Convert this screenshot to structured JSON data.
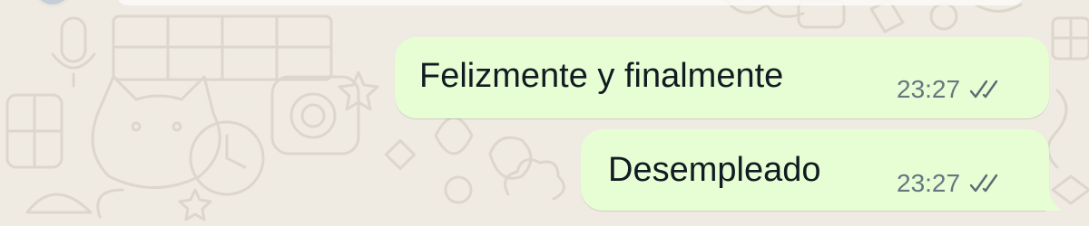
{
  "chat": {
    "background_color": "#efeae2",
    "outgoing_bubble_color": "#e7fdd4",
    "messages": [
      {
        "text": "Felizmente y finalmente",
        "time": "23:27",
        "status": "double-check-icon",
        "direction": "outgoing"
      },
      {
        "text": "Desempleado",
        "time": "23:27",
        "status": "double-check-icon",
        "direction": "outgoing"
      }
    ]
  }
}
